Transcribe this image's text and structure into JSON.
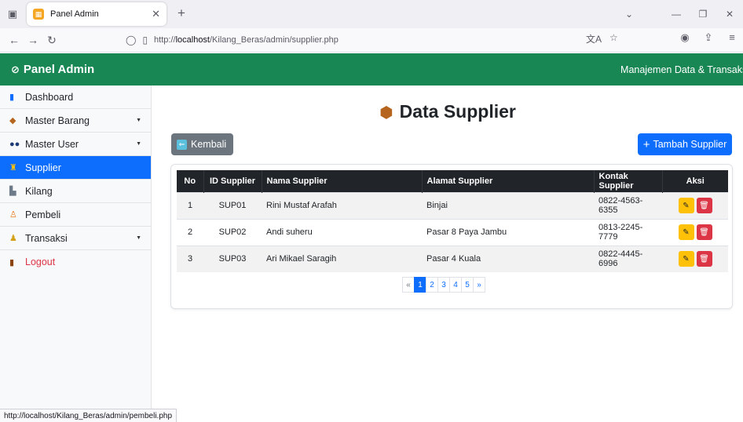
{
  "browser": {
    "tab_title": "Panel Admin",
    "url_prefix": "http://",
    "url_host": "localhost",
    "url_path": "/Kilang_Beras/admin/supplier.php",
    "status_url": "http://localhost/Kilang_Beras/admin/pembeli.php"
  },
  "header": {
    "brand": "Panel Admin",
    "subtitle": "Manajemen Data & Transaksi"
  },
  "sidebar": {
    "items": [
      {
        "label": "Dashboard",
        "icon": "bar-chart-icon"
      },
      {
        "label": "Master Barang",
        "icon": "box-icon",
        "dropdown": true
      },
      {
        "label": "Master User",
        "icon": "users-icon",
        "dropdown": true
      },
      {
        "label": "Supplier",
        "icon": "supplier-icon",
        "active": true
      },
      {
        "label": "Kilang",
        "icon": "factory-icon"
      },
      {
        "label": "Pembeli",
        "icon": "buyer-icon"
      },
      {
        "label": "Transaksi",
        "icon": "money-bag-icon",
        "dropdown": true
      },
      {
        "label": "Logout",
        "icon": "door-icon"
      }
    ]
  },
  "main": {
    "title": "Data Supplier",
    "back_label": "Kembali",
    "add_label": "Tambah Supplier",
    "table": {
      "headers": [
        "No",
        "ID Supplier",
        "Nama Supplier",
        "Alamat Supplier",
        "Kontak Supplier",
        "Aksi"
      ],
      "rows": [
        {
          "no": "1",
          "id": "SUP01",
          "nama": "Rini Mustaf Arafah",
          "alamat": "Binjai",
          "kontak": "0822-4563-6355"
        },
        {
          "no": "2",
          "id": "SUP02",
          "nama": "Andi suheru",
          "alamat": "Pasar 8 Paya Jambu",
          "kontak": "0813-2245-7779"
        },
        {
          "no": "3",
          "id": "SUP03",
          "nama": "Ari Mikael Saragih",
          "alamat": "Pasar 4 Kuala",
          "kontak": "0822-4445-6996"
        }
      ]
    },
    "pagination": {
      "prev": "«",
      "pages": [
        "1",
        "2",
        "3",
        "4",
        "5"
      ],
      "current": "1",
      "next": "»"
    }
  },
  "colors": {
    "header_green": "#198754",
    "primary": "#0d6efd",
    "secondary": "#6c757d",
    "warning": "#ffc107",
    "danger": "#dc3545"
  }
}
